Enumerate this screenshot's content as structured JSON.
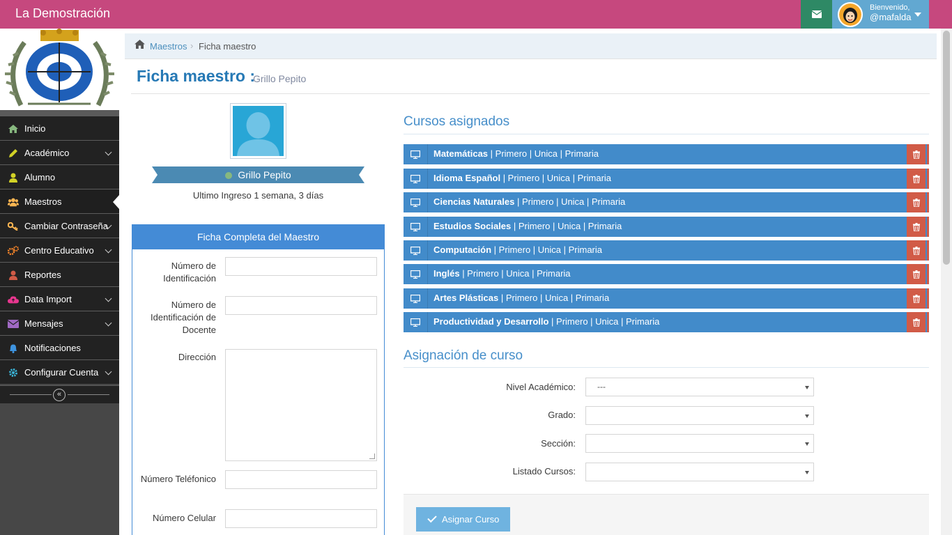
{
  "navbar": {
    "brand": "La Demostración",
    "welcome": "Bienvenido,",
    "username": "@mafalda"
  },
  "sidebar": {
    "items": [
      {
        "label": "Inicio",
        "icon": "home-icon",
        "icon_color": "#87b87f"
      },
      {
        "label": "Académico",
        "icon": "pencil-icon",
        "icon_color": "#d2d226"
      },
      {
        "label": "Alumno",
        "icon": "user-icon",
        "icon_color": "#d2d226"
      },
      {
        "label": "Maestros",
        "icon": "users-icon",
        "icon_color": "#ffb752"
      },
      {
        "label": "Cambiar Contraseña",
        "icon": "key-icon",
        "icon_color": "#ffb752"
      },
      {
        "label": "Centro Educativo",
        "icon": "cogs-icon",
        "icon_color": "#ff892a"
      },
      {
        "label": "Reportes",
        "icon": "user-icon",
        "icon_color": "#d15b47"
      },
      {
        "label": "Data Import",
        "icon": "cloud-upload-icon",
        "icon_color": "#e8368f"
      },
      {
        "label": "Mensajes",
        "icon": "envelope-icon",
        "icon_color": "#a069c3"
      },
      {
        "label": "Notificaciones",
        "icon": "bell-icon",
        "icon_color": "#3e94e0"
      },
      {
        "label": "Configurar Cuenta",
        "icon": "gear-icon",
        "icon_color": "#3ab3d6"
      }
    ]
  },
  "breadcrumb": {
    "link": "Maestros",
    "current": "Ficha maestro"
  },
  "page": {
    "title": "Ficha maestro :",
    "subtitle": "Grillo Pepito"
  },
  "profile": {
    "name": "Grillo Pepito",
    "last_login": "Ultimo Ingreso 1 semana, 3 días"
  },
  "form": {
    "heading": "Ficha Completa del Maestro",
    "fields": {
      "id_number": "Número de Identificación",
      "teacher_id": "Número de Identificación de Docente",
      "address": "Dirección",
      "phone": "Número Teléfonico",
      "cell": "Número Celular"
    }
  },
  "courses": {
    "title": "Cursos asignados",
    "items": [
      {
        "name": "Matemáticas",
        "details": " | Primero | Unica | Primaria"
      },
      {
        "name": "Idioma Español",
        "details": " | Primero | Unica | Primaria"
      },
      {
        "name": "Ciencias Naturales",
        "details": " | Primero | Unica | Primaria"
      },
      {
        "name": "Estudios Sociales",
        "details": " | Primero | Unica | Primaria"
      },
      {
        "name": "Computación",
        "details": " | Primero | Unica | Primaria"
      },
      {
        "name": "Inglés",
        "details": " | Primero | Unica | Primaria"
      },
      {
        "name": "Artes Plásticas",
        "details": " | Primero | Unica | Primaria"
      },
      {
        "name": "Productividad y Desarrollo",
        "details": " | Primero | Unica | Primaria"
      }
    ]
  },
  "assignment": {
    "title": "Asignación de curso",
    "nivel_label": "Nivel Académico:",
    "nivel_value": "---",
    "grado_label": "Grado:",
    "seccion_label": "Sección:",
    "listado_label": "Listado Cursos:",
    "button": "Asignar Curso"
  },
  "colors": {
    "navbar": "#c6487e",
    "primary": "#428bca",
    "danger": "#d15b47"
  }
}
